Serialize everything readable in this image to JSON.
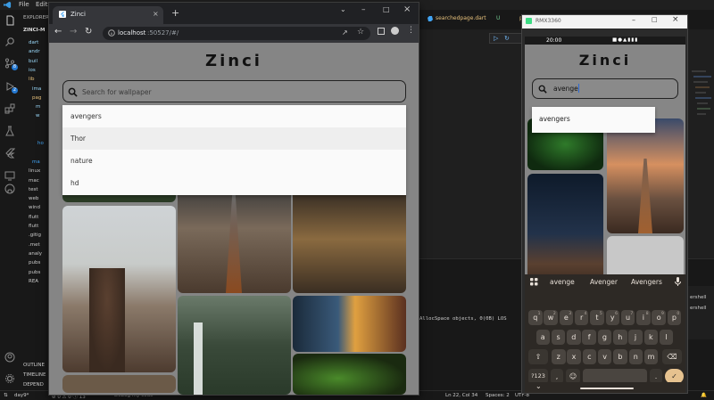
{
  "vscode": {
    "menu": [
      "File",
      "Edit"
    ],
    "explorer_title": "EXPLORER",
    "project": "ZINCI-M",
    "tree": [
      "dart",
      "andr",
      "buil",
      "ios",
      "lib",
      "ima",
      "pag",
      "m",
      "w",
      "",
      "",
      "ho",
      "",
      "ma",
      "linux",
      "mac",
      "test",
      "web",
      "wind",
      "flutt",
      "flutt",
      ".gitig",
      ".met",
      "analy",
      "pubs",
      "pubs",
      "REA"
    ],
    "sections": [
      "OUTLINE",
      "TIMELINE",
      "DEPEND"
    ],
    "tabs": [
      {
        "label": "searchedpage.dart",
        "modifier": "U"
      },
      {
        "label": "p",
        "modifier": ""
      }
    ],
    "terminal_line": "AllocSpace objects, 0(0B) LOS",
    "terminal_right": [
      "ershell",
      "ershell"
    ],
    "status_left": [
      "day9*",
      "⊘ 0 ⚠ 0 ⓘ 13",
      "Debug my code"
    ],
    "status_right": [
      "Ln 22, Col 34",
      "Spaces: 2",
      "UTF-8"
    ],
    "badges": [
      "8",
      "2"
    ]
  },
  "chrome": {
    "tab_title": "Zinci",
    "url_host": "localhost",
    "url_rest": ":50527/#/"
  },
  "web_app": {
    "title": "Zinci",
    "search_placeholder": "Search for wallpaper",
    "suggestions": [
      "avengers",
      "Thor",
      "nature",
      "hd"
    ]
  },
  "emulator": {
    "window_title": "RMX3360",
    "time": "20:00",
    "app_title": "Zinci",
    "search_value": "avenge",
    "suggestions": [
      "avengers"
    ],
    "keyboard": {
      "suggestions": [
        "avenge",
        "Avenger",
        "Avengers"
      ],
      "row1": [
        "q",
        "w",
        "e",
        "r",
        "t",
        "y",
        "u",
        "i",
        "o",
        "p"
      ],
      "row1_hints": [
        "1",
        "2",
        "3",
        "4",
        "5",
        "6",
        "7",
        "8",
        "9",
        "0"
      ],
      "row2": [
        "a",
        "s",
        "d",
        "f",
        "g",
        "h",
        "j",
        "k",
        "l"
      ],
      "row3": [
        "z",
        "x",
        "c",
        "v",
        "b",
        "n",
        "m"
      ],
      "symbols": "?123",
      "comma": ",",
      "period": "."
    }
  },
  "colors": {
    "vscode_bg": "#1e1e1e",
    "status_accent": "#2478d1",
    "app_bg": "#858585",
    "keyboard_bg": "#2d2925",
    "enter_key": "#e6c28f"
  }
}
